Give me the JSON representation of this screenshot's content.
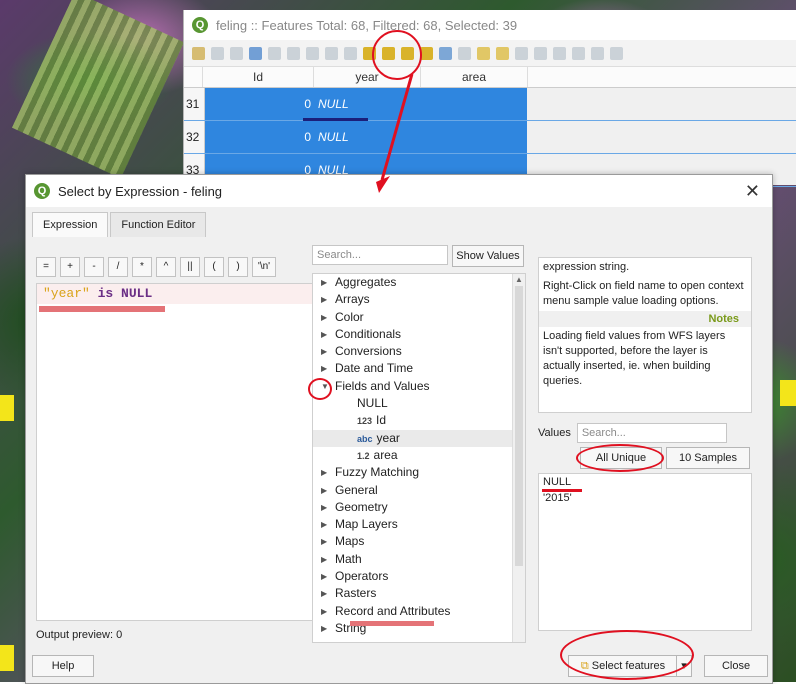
{
  "attribute_table": {
    "title": "feling :: Features Total: 68, Filtered: 68, Selected: 39",
    "columns": [
      "Id",
      "year",
      "area"
    ],
    "rows": [
      {
        "num": "31",
        "id": "0",
        "year": "NULL"
      },
      {
        "num": "32",
        "id": "0",
        "year": "NULL"
      },
      {
        "num": "33",
        "id": "0",
        "year": "NULL"
      }
    ]
  },
  "dialog": {
    "title": "Select by Expression - feling",
    "tabs": [
      "Expression",
      "Function Editor"
    ],
    "operators": [
      "=",
      "+",
      "-",
      "/",
      "*",
      "^",
      "||",
      "(",
      ")",
      "'\\n'"
    ],
    "expression": {
      "field": "\"year\"",
      "keyword1": "is",
      "keyword2": "NULL"
    },
    "output_preview": "Output preview:  0",
    "search_placeholder": "Search...",
    "show_values": "Show Values",
    "function_groups_before": [
      "Aggregates",
      "Arrays",
      "Color",
      "Conditionals",
      "Conversions",
      "Date and Time"
    ],
    "fields_group": "Fields and Values",
    "fields_children": [
      {
        "tag": "",
        "label": "NULL"
      },
      {
        "tag": "123",
        "label": "Id"
      },
      {
        "tag": "abc",
        "label": "year"
      },
      {
        "tag": "1.2",
        "label": "area"
      }
    ],
    "function_groups_after": [
      "Fuzzy Matching",
      "General",
      "Geometry",
      "Map Layers",
      "Maps",
      "Math",
      "Operators",
      "Rasters",
      "Record and Attributes",
      "String"
    ],
    "help_text_1": "expression string.",
    "help_text_2": "Right-Click on field name to open context menu sample value loading options.",
    "notes_label": "Notes",
    "help_text_3": "Loading field values from WFS layers isn't supported, before the layer is actually inserted, ie. when building queries.",
    "values_label": "Values",
    "values_search_placeholder": "Search...",
    "all_unique": "All Unique",
    "ten_samples": "10 Samples",
    "values_list": [
      "NULL",
      "'2015'"
    ],
    "help_button": "Help",
    "select_features": "Select features",
    "close_button": "Close"
  }
}
